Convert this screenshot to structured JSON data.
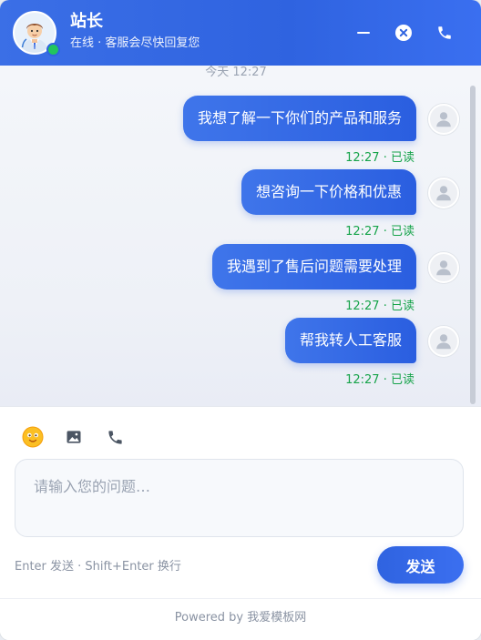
{
  "header": {
    "agent_name": "站长",
    "agent_status": "在线 · 客服会尽快回复您",
    "online_color": "#22c55e"
  },
  "chat": {
    "date_separator": "今天 12:27",
    "messages": [
      {
        "text": "我想了解一下你们的产品和服务",
        "time": "12:27",
        "status": "已读"
      },
      {
        "text": "想咨询一下价格和优惠",
        "time": "12:27",
        "status": "已读"
      },
      {
        "text": "我遇到了售后问题需要处理",
        "time": "12:27",
        "status": "已读"
      },
      {
        "text": "帮我转人工客服",
        "time": "12:27",
        "status": "已读"
      }
    ]
  },
  "composer": {
    "tools": [
      "emoji-icon",
      "image-icon",
      "phone-icon"
    ],
    "placeholder": "请输入您的问题…",
    "value": "",
    "hint": "Enter 发送 · Shift+Enter 换行",
    "send_label": "发送"
  },
  "footer": {
    "text": "Powered by 我爱模板网"
  },
  "colors": {
    "accent": "#2f63e0",
    "read_status": "#16a34a"
  }
}
